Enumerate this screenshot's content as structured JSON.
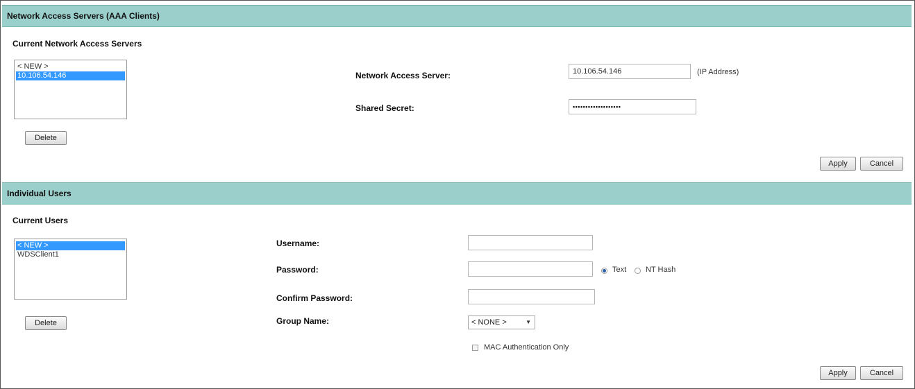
{
  "nas_section": {
    "title": "Network Access Servers (AAA Clients)",
    "list_title": "Current Network Access Servers",
    "list_items": [
      "< NEW >",
      "10.106.54.146"
    ],
    "selected_index": 1,
    "delete_label": "Delete",
    "server_label": "Network Access Server:",
    "server_value": "10.106.54.146",
    "server_hint": "(IP Address)",
    "secret_label": "Shared Secret:",
    "secret_value": "•••••••••••••••••••",
    "apply_label": "Apply",
    "cancel_label": "Cancel"
  },
  "users_section": {
    "title": "Individual Users",
    "list_title": "Current Users",
    "list_items": [
      "< NEW >",
      "WDSClient1"
    ],
    "selected_index": 0,
    "delete_label": "Delete",
    "username_label": "Username:",
    "username_value": "",
    "password_label": "Password:",
    "password_value": "",
    "password_type_options": [
      "Text",
      "NT Hash"
    ],
    "password_type_selected": "Text",
    "confirm_label": "Confirm Password:",
    "confirm_value": "",
    "group_label": "Group Name:",
    "group_value": "< NONE >",
    "mac_auth_label": "MAC Authentication Only",
    "mac_auth_checked": false,
    "apply_label": "Apply",
    "cancel_label": "Cancel"
  },
  "colors": {
    "header_bg": "#9bcfcb",
    "selection": "#3399ff"
  }
}
